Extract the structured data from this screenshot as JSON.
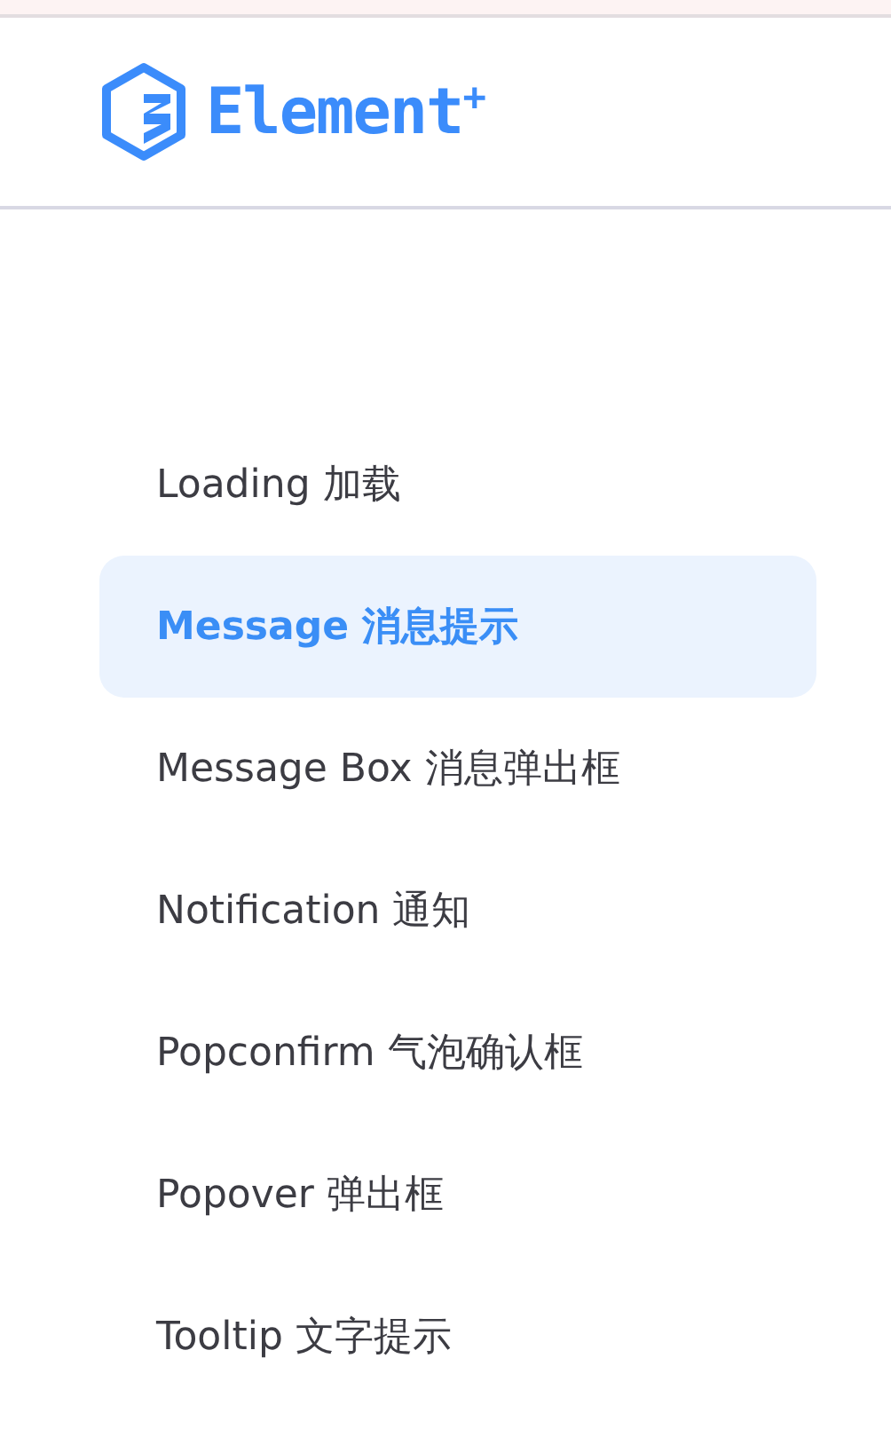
{
  "logo": {
    "wordmark": "Element$^{+}$"
  },
  "menu": [
    {
      "label": "Loading 加载",
      "selected": false
    },
    {
      "label": "Message 消息提示",
      "selected": true
    },
    {
      "label": "Message Box 消息弹出框",
      "selected": false
    },
    {
      "label": "Notification 通知",
      "selected": false
    },
    {
      "label": "Popconfirm 气泡确认框",
      "selected": false
    },
    {
      "label": "Popover 弹出框",
      "selected": false
    },
    {
      "label": "Tooltip 文字提示",
      "selected": false
    }
  ]
}
